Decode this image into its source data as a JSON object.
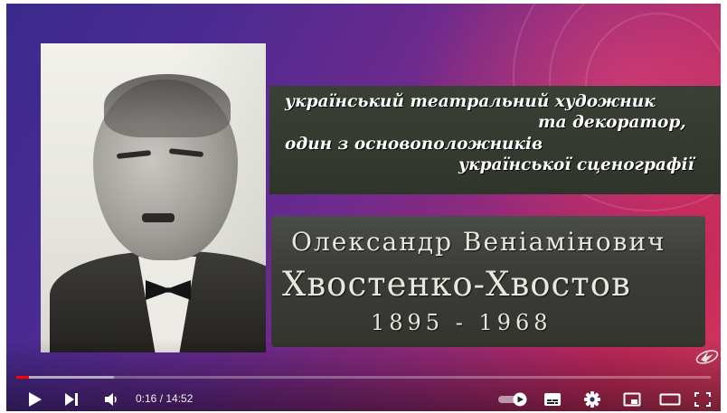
{
  "video": {
    "subtitle_lines": [
      "український театральний художник",
      "та декоратор,",
      "один з основоположників",
      "української сценографії"
    ],
    "name_line1": "Олександр Веніамінович",
    "name_line2": "Хвостенко-Хвостов",
    "years": "1895 - 1968"
  },
  "player": {
    "current_time": "0:16",
    "separator": " / ",
    "duration": "14:52",
    "played_fraction": 0.018,
    "buffered_fraction": 0.14,
    "accent_color": "#ff0000"
  },
  "icons": {
    "play": "play-icon",
    "next": "next-icon",
    "volume": "volume-icon",
    "autoplay": "autoplay-toggle-icon",
    "subtitles": "subtitles-icon",
    "settings": "gear-icon",
    "miniplayer": "miniplayer-icon",
    "theater": "theater-mode-icon",
    "fullscreen": "fullscreen-icon"
  }
}
